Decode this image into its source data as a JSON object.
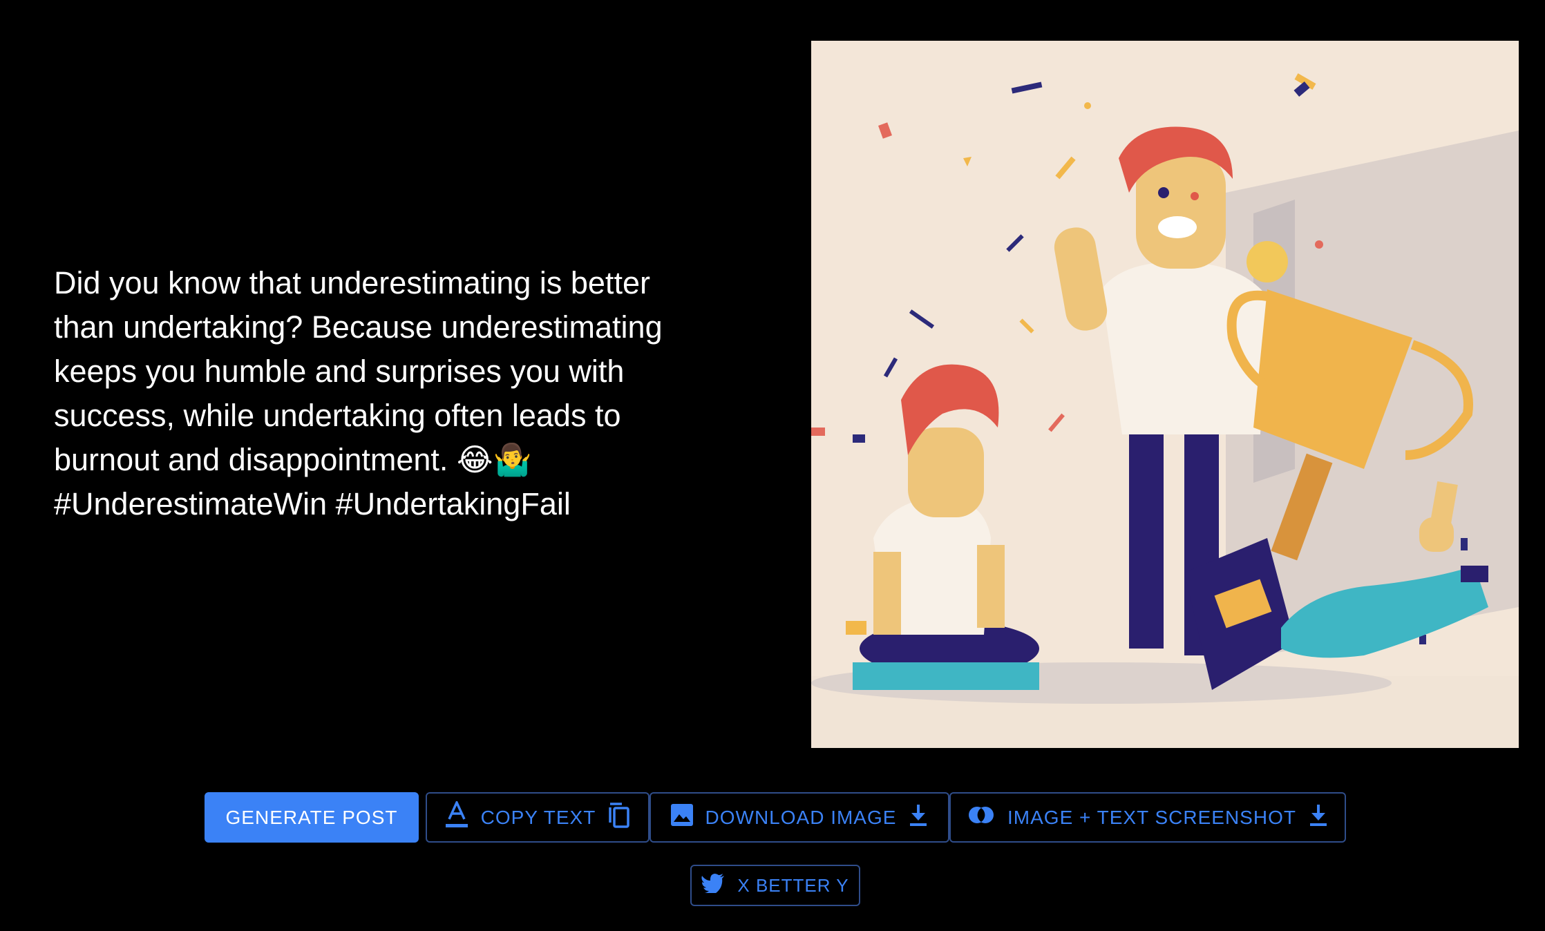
{
  "post": {
    "text": "Did you know that underestimating is better\nthan undertaking? Because underestimating\nkeeps you humble and surprises you with\nsuccess, while undertaking often leads to\nburnout and disappointment. 😂🤷‍♂️\n#UnderestimateWin #UndertakingFail"
  },
  "image": {
    "subject": "illustration: man with trophy celebrating, confetti, two other people on the floor"
  },
  "actions": {
    "generate_label": "GENERATE POST",
    "copy_label": "COPY TEXT",
    "download_label": "DOWNLOAD IMAGE",
    "screenshot_label": "IMAGE + TEXT SCREENSHOT",
    "extra_label": "X BETTER Y"
  },
  "icons": {
    "copy_leading": "text-format-icon",
    "copy_trailing": "copy-icon",
    "download_leading": "image-icon",
    "download_trailing": "download-icon",
    "screenshot_leading": "contrast-icon",
    "screenshot_trailing": "download-icon",
    "extra_leading": "twitter-icon"
  },
  "colors": {
    "background": "#000000",
    "accent": "#3b82f6",
    "button_border": "#2f4d8a",
    "image_background": "#f3e6d8"
  }
}
